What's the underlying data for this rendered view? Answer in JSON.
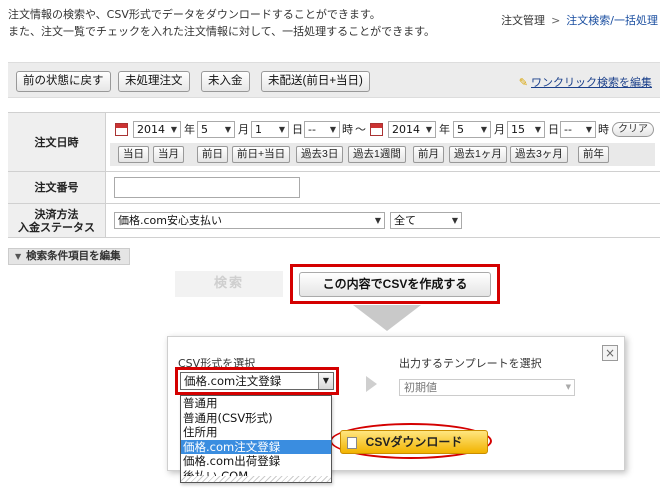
{
  "intro": {
    "line1": "注文情報の検索や、CSV形式でデータをダウンロードすることができます。",
    "line2": "また、注文一覧でチェックを入れた注文情報に対して、一括処理することができます。"
  },
  "breadcrumb": {
    "parent": "注文管理",
    "separator": ">",
    "current": "注文検索/一括処理"
  },
  "toolbar": {
    "buttons": [
      "前の状態に戻す",
      "未処理注文",
      "未入金",
      "未配送(前日+当日)"
    ],
    "oneclick_label": "ワンクリック検索を編集"
  },
  "search": {
    "date": {
      "label": "注文日時",
      "from": {
        "year": "2014",
        "month": "5",
        "day": "1",
        "hour": "--"
      },
      "to": {
        "year": "2014",
        "month": "5",
        "day": "15",
        "hour": "--"
      },
      "unit_year": "年",
      "unit_month": "月",
      "unit_day": "日",
      "unit_hour": "時",
      "range_sep": "～",
      "clear_label": "クリア",
      "quick": [
        "当日",
        "当月",
        "前日",
        "前日+当日",
        "過去3日",
        "過去1週間",
        "前月",
        "過去1ヶ月",
        "過去3ヶ月",
        "前年"
      ]
    },
    "order_no": {
      "label": "注文番号",
      "value": ""
    },
    "payment": {
      "label1": "決済方法",
      "label2": "入金ステータス",
      "method": "価格.com安心支払い",
      "status": "全て"
    }
  },
  "edit_conditions_label": "検索条件項目を編集",
  "search_button": "検索",
  "create_csv_button": "この内容でCSVを作成する",
  "csv_panel": {
    "format_label": "CSV形式を選択",
    "format_selected": "価格.com注文登録",
    "template_label": "出力するテンプレートを選択",
    "template_selected": "初期値",
    "options": [
      "普通用",
      "普通用(CSV形式)",
      "住所用",
      "価格.com注文登録",
      "価格.com出荷登録",
      "後払い.COM"
    ],
    "highlighted_index": 3,
    "download_button": "CSVダウンロード",
    "close_symbol": "×"
  },
  "colors": {
    "highlight_red": "#d40000",
    "link_blue": "#1a4ea0",
    "download_yellow": "#f2b300",
    "option_highlight": "#3a8de0"
  }
}
